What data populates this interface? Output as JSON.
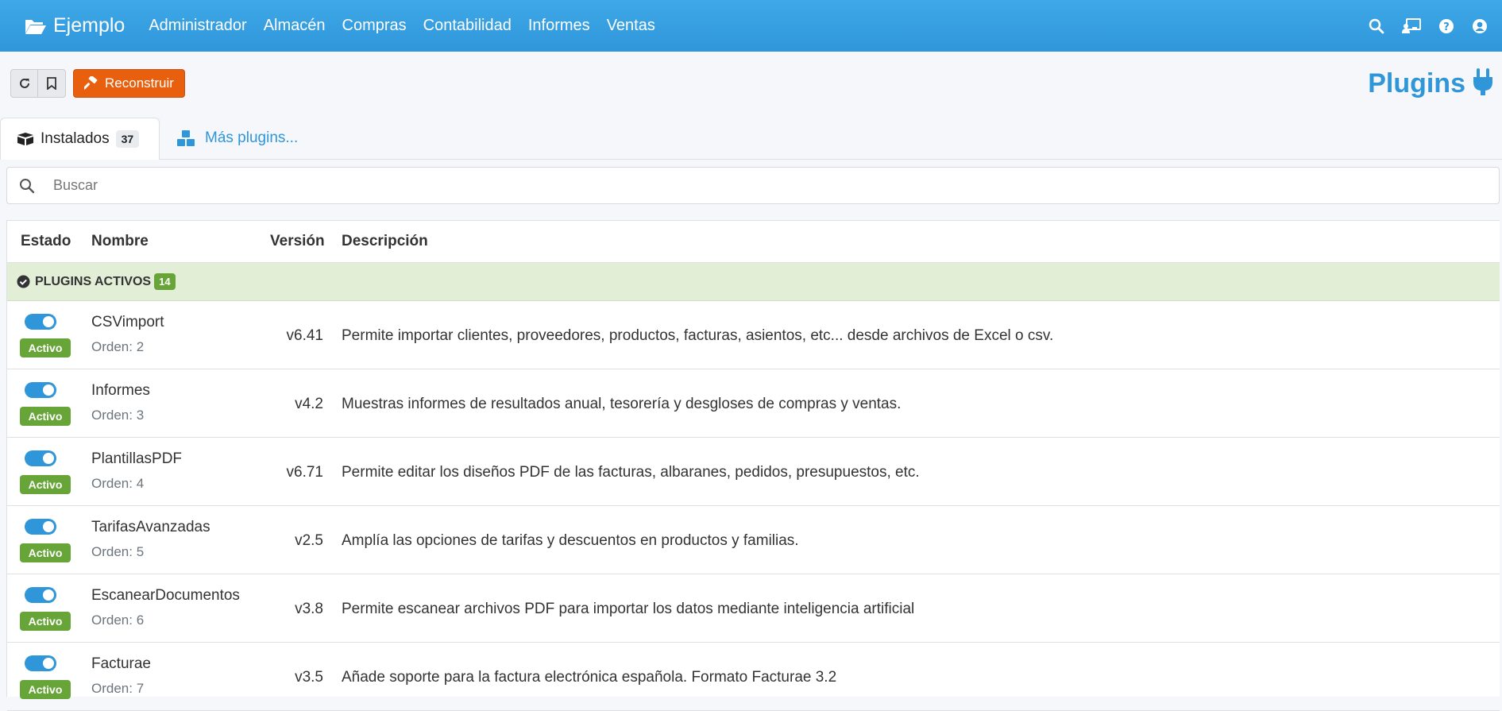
{
  "navbar": {
    "brand": "Ejemplo",
    "menu": [
      "Administrador",
      "Almacén",
      "Compras",
      "Contabilidad",
      "Informes",
      "Ventas"
    ],
    "icons": [
      "search-icon",
      "chalkboard-user-icon",
      "help-icon",
      "user-icon"
    ]
  },
  "toolbar": {
    "rebuild_label": "Reconstruir",
    "page_title": "Plugins"
  },
  "tabs": {
    "installed_label": "Instalados",
    "installed_count": "37",
    "more_label": "Más plugins..."
  },
  "search": {
    "placeholder": "Buscar"
  },
  "table": {
    "headers": {
      "status": "Estado",
      "name": "Nombre",
      "version": "Versión",
      "description": "Descripción"
    },
    "group": {
      "label": "PLUGINS ACTIVOS",
      "count": "14"
    },
    "rows": [
      {
        "status": "Activo",
        "name": "CSVimport",
        "order": "Orden: 2",
        "version": "v6.41",
        "description": "Permite importar clientes, proveedores, productos, facturas, asientos, etc... desde archivos de Excel o csv."
      },
      {
        "status": "Activo",
        "name": "Informes",
        "order": "Orden: 3",
        "version": "v4.2",
        "description": "Muestras informes de resultados anual, tesorería y desgloses de compras y ventas."
      },
      {
        "status": "Activo",
        "name": "PlantillasPDF",
        "order": "Orden: 4",
        "version": "v6.71",
        "description": "Permite editar los diseños PDF de las facturas, albaranes, pedidos, presupuestos, etc."
      },
      {
        "status": "Activo",
        "name": "TarifasAvanzadas",
        "order": "Orden: 5",
        "version": "v2.5",
        "description": "Amplía las opciones de tarifas y descuentos en productos y familias."
      },
      {
        "status": "Activo",
        "name": "EscanearDocumentos",
        "order": "Orden: 6",
        "version": "v3.8",
        "description": "Permite escanear archivos PDF para importar los datos mediante inteligencia artificial"
      },
      {
        "status": "Activo",
        "name": "Facturae",
        "order": "Orden: 7",
        "version": "v3.5",
        "description": "Añade soporte para la factura electrónica española. Formato Facturae 3.2"
      }
    ]
  },
  "colors": {
    "primary": "#2e96d9",
    "rebuild": "#e8600e",
    "success": "#67a538"
  }
}
